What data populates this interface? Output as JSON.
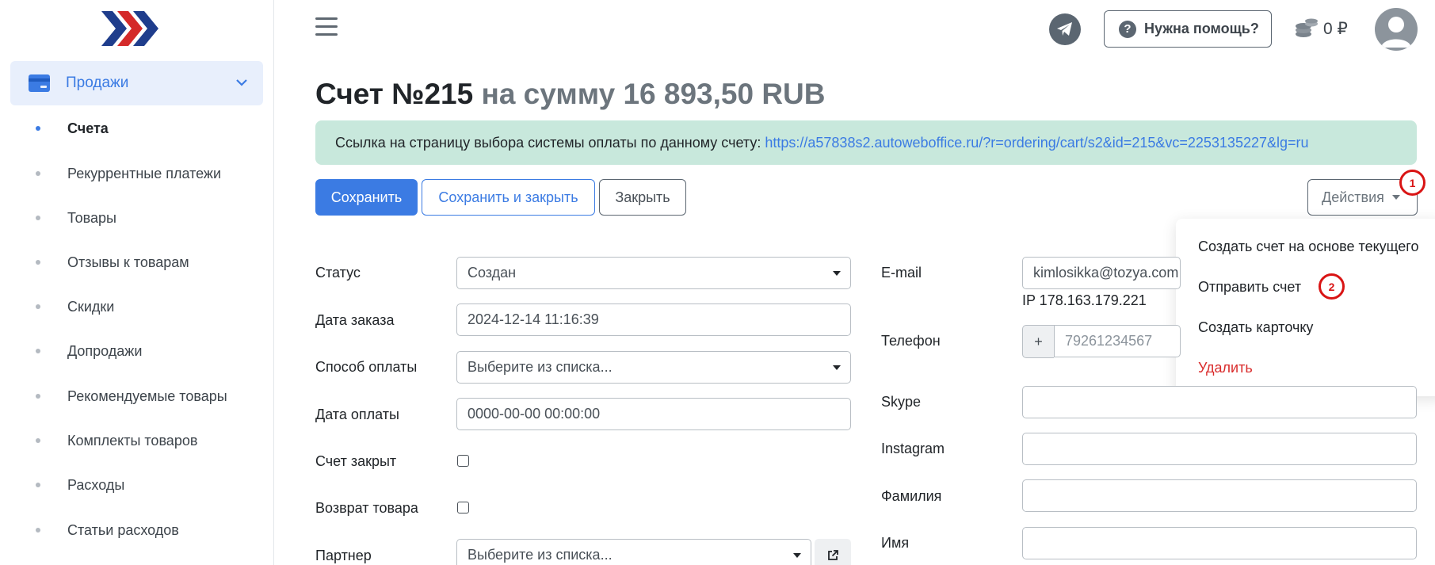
{
  "sidebar": {
    "group_label": "Продажи",
    "items": [
      {
        "label": "Счета",
        "active": true
      },
      {
        "label": "Рекуррентные платежи",
        "active": false
      },
      {
        "label": "Товары",
        "active": false
      },
      {
        "label": "Отзывы к товарам",
        "active": false
      },
      {
        "label": "Скидки",
        "active": false
      },
      {
        "label": "Допродажи",
        "active": false
      },
      {
        "label": "Рекомендуемые товары",
        "active": false
      },
      {
        "label": "Комплекты товаров",
        "active": false
      },
      {
        "label": "Расходы",
        "active": false
      },
      {
        "label": "Статьи расходов",
        "active": false
      }
    ]
  },
  "header": {
    "help_label": "Нужна помощь?",
    "balance": "0 ₽"
  },
  "page": {
    "title_main": "Счет №215",
    "title_sum": "на сумму 16 893,50 RUB"
  },
  "alert": {
    "text": "Ссылка на страницу выбора системы оплаты по данному счету:",
    "link": "https://a57838s2.autoweboffice.ru/?r=ordering/cart/s2&id=215&vc=2253135227&lg=ru"
  },
  "toolbar": {
    "save": "Сохранить",
    "save_close": "Сохранить и закрыть",
    "close": "Закрыть",
    "actions": "Действия"
  },
  "markers": {
    "one": "1",
    "two": "2"
  },
  "actions_menu": {
    "items": [
      "Создать счет на основе текущего",
      "Отправить счет",
      "Создать карточку",
      "Удалить"
    ]
  },
  "form_left": {
    "status_label": "Статус",
    "status_value": "Создан",
    "order_date_label": "Дата заказа",
    "order_date_value": "2024-12-14 11:16:39",
    "payment_method_label": "Способ оплаты",
    "payment_method_value": "Выберите из списка...",
    "payment_date_label": "Дата оплаты",
    "payment_date_value": "0000-00-00 00:00:00",
    "closed_label": "Счет закрыт",
    "return_label": "Возврат товара",
    "partner_label": "Партнер",
    "partner_value": "Выберите из списка..."
  },
  "form_right": {
    "email_label": "E-mail",
    "email_value": "kimlosikka@tozya.com",
    "ip": "IP 178.163.179.221",
    "phone_label": "Телефон",
    "phone_prefix": "+",
    "phone_value": "79261234567",
    "skype_label": "Skype",
    "instagram_label": "Instagram",
    "surname_label": "Фамилия",
    "name_label": "Имя"
  },
  "colors": {
    "accent": "#3b7be3",
    "alert_bg": "#c8e8dc",
    "danger": "#d92b2b",
    "marker": "#d91414"
  }
}
